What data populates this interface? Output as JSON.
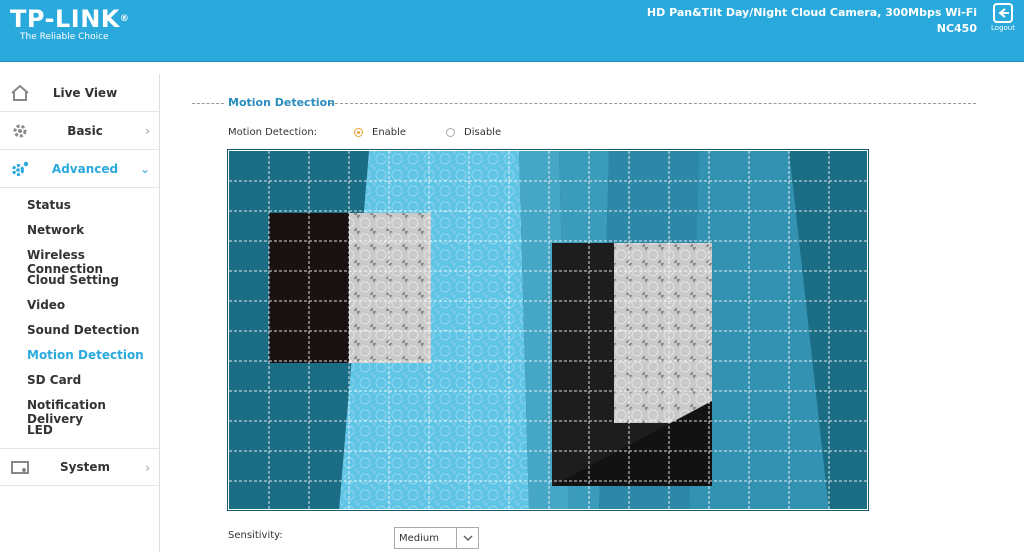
{
  "header": {
    "brand": "TP-LINK",
    "brand_reg": "®",
    "tagline": "The Reliable Choice",
    "product_name": "HD Pan&Tilt Day/Night Cloud Camera, 300Mbps Wi-Fi",
    "model": "NC450",
    "logout_label": "Logout"
  },
  "sidebar": {
    "main_items": [
      {
        "label": "Live View",
        "icon": "home-icon"
      },
      {
        "label": "Basic",
        "icon": "gear-icon"
      },
      {
        "label": "Advanced",
        "icon": "advanced-gear-icon"
      },
      {
        "label": "System",
        "icon": "system-icon"
      }
    ],
    "sub_items": [
      "Status",
      "Network",
      "Wireless Connection",
      "Cloud Setting",
      "Video",
      "Sound Detection",
      "Motion Detection",
      "SD Card",
      "Notification Delivery",
      "LED"
    ],
    "active_sub": "Motion Detection"
  },
  "main": {
    "section_title": "Motion Detection",
    "motion_detection_label": "Motion Detection:",
    "enable_label": "Enable",
    "disable_label": "Disable",
    "selected": "Enable",
    "sensitivity_label": "Sensitivity:",
    "sensitivity_value": "Medium"
  },
  "colors": {
    "accent": "#2aa9dc",
    "header_bg": "#2aa9dc",
    "radio_on": "#f0a030",
    "cam_overlay": "#1b6d85"
  }
}
